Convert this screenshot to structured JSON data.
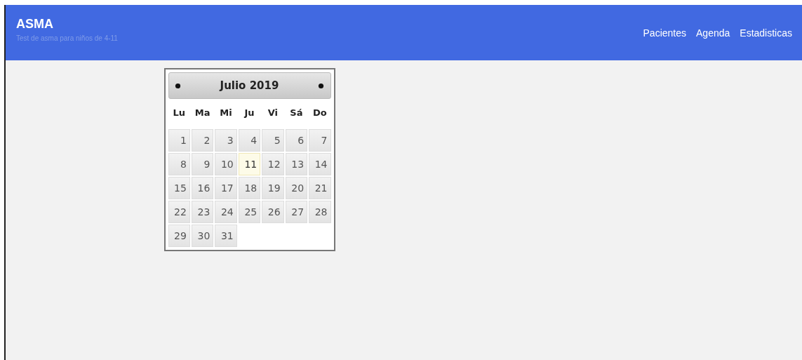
{
  "header": {
    "title": "ASMA",
    "subtitle": "Test de asma para niños de 4-11",
    "nav": [
      "Pacientes",
      "Agenda",
      "Estadisticas"
    ]
  },
  "calendar": {
    "title": "Julio 2019",
    "weekdays": [
      "Lu",
      "Ma",
      "Mi",
      "Ju",
      "Vi",
      "Sá",
      "Do"
    ],
    "weeks": [
      [
        {
          "day": "1",
          "today": false
        },
        {
          "day": "2",
          "today": false
        },
        {
          "day": "3",
          "today": false
        },
        {
          "day": "4",
          "today": false
        },
        {
          "day": "5",
          "today": false
        },
        {
          "day": "6",
          "today": false
        },
        {
          "day": "7",
          "today": false
        }
      ],
      [
        {
          "day": "8",
          "today": false
        },
        {
          "day": "9",
          "today": false
        },
        {
          "day": "10",
          "today": false
        },
        {
          "day": "11",
          "today": true
        },
        {
          "day": "12",
          "today": false
        },
        {
          "day": "13",
          "today": false
        },
        {
          "day": "14",
          "today": false
        }
      ],
      [
        {
          "day": "15",
          "today": false
        },
        {
          "day": "16",
          "today": false
        },
        {
          "day": "17",
          "today": false
        },
        {
          "day": "18",
          "today": false
        },
        {
          "day": "19",
          "today": false
        },
        {
          "day": "20",
          "today": false
        },
        {
          "day": "21",
          "today": false
        }
      ],
      [
        {
          "day": "22",
          "today": false
        },
        {
          "day": "23",
          "today": false
        },
        {
          "day": "24",
          "today": false
        },
        {
          "day": "25",
          "today": false
        },
        {
          "day": "26",
          "today": false
        },
        {
          "day": "27",
          "today": false
        },
        {
          "day": "28",
          "today": false
        }
      ],
      [
        {
          "day": "29",
          "today": false
        },
        {
          "day": "30",
          "today": false
        },
        {
          "day": "31",
          "today": false
        }
      ]
    ]
  }
}
